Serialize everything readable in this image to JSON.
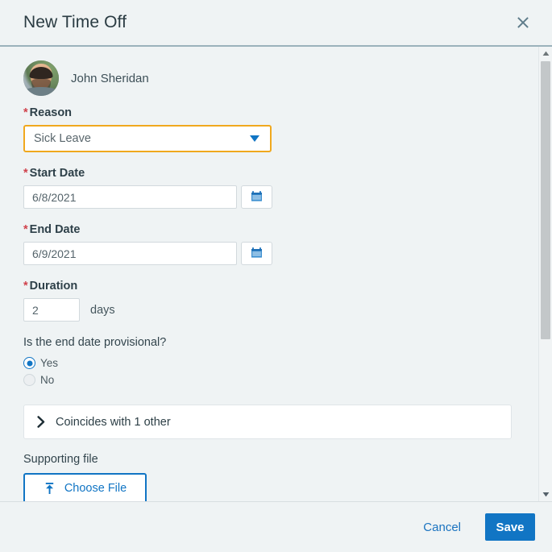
{
  "dialog": {
    "title": "New Time Off",
    "close_icon": "close-icon"
  },
  "user": {
    "name": "John Sheridan",
    "avatar_icon": "user-avatar-photo"
  },
  "fields": {
    "reason": {
      "label": "Reason",
      "required_marker": "*",
      "value": "Sick Leave",
      "caret_icon": "chevron-down-icon"
    },
    "start_date": {
      "label": "Start Date",
      "required_marker": "*",
      "value": "6/8/2021",
      "calendar_icon": "calendar-icon"
    },
    "end_date": {
      "label": "End Date",
      "required_marker": "*",
      "value": "6/9/2021",
      "calendar_icon": "calendar-icon"
    },
    "duration": {
      "label": "Duration",
      "required_marker": "*",
      "value": "2",
      "unit": "days"
    },
    "provisional": {
      "label": "Is the end date provisional?",
      "options": [
        {
          "label": "Yes",
          "selected": true
        },
        {
          "label": "No",
          "selected": false
        }
      ]
    },
    "coincides": {
      "text": "Coincides with 1 other",
      "expand_icon": "chevron-right-icon"
    },
    "supporting_file": {
      "label": "Supporting file",
      "button_label": "Choose File",
      "upload_icon": "upload-icon"
    }
  },
  "scrollbar": {
    "up_icon": "scroll-up-arrow-icon",
    "down_icon": "scroll-down-arrow-icon"
  },
  "footer": {
    "cancel_label": "Cancel",
    "save_label": "Save"
  },
  "colors": {
    "accent_blue": "#1175c4",
    "focus_amber": "#f0a81e",
    "required_red": "#d0424c",
    "panel_bg": "#eff3f4"
  }
}
